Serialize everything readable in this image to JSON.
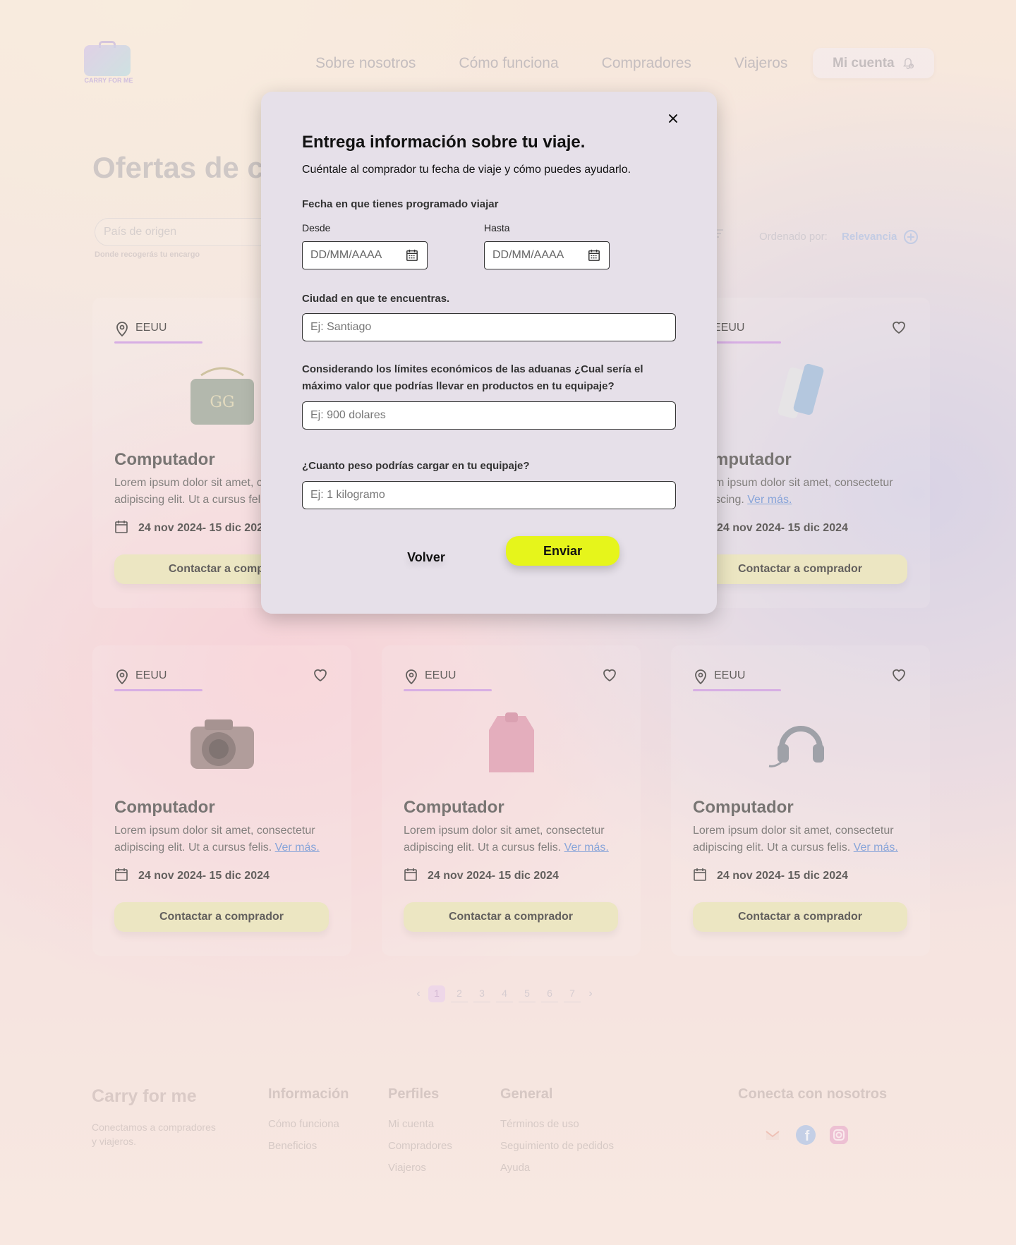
{
  "brand": {
    "logo_text": "CARRY FOR ME"
  },
  "nav": {
    "items": [
      "Sobre nosotros",
      "Cómo funciona",
      "Compradores",
      "Viajeros"
    ],
    "account_label": "Mi cuenta"
  },
  "page": {
    "title": "Ofertas de co",
    "origin_placeholder": "País de origen",
    "origin_hint": "Donde recogerás tu encargo",
    "sort_label": "Ordenado por:",
    "sort_value": "Relevancia"
  },
  "cards": [
    {
      "location": "EEUU",
      "title": "Computador",
      "desc": "Lorem ipsum dolor sit amet, c",
      "desc2": "adipiscing elit. Ut a cursus fel",
      "more": "",
      "dates": "24 nov 2024- 15 dic 2024",
      "button": "Contactar a compra",
      "image": "handbag"
    },
    {
      "location": "EEUU",
      "title": "mputador",
      "desc": "m ipsum dolor sit amet, consectetur",
      "desc2": "scing.",
      "more": "Ver más.",
      "dates": "24 nov 2024- 15 dic 2024",
      "button": "Contactar a comprador",
      "image": "phone"
    },
    {
      "location": "EEUU",
      "title": "Computador",
      "desc": "Lorem ipsum dolor sit amet, consectetur",
      "desc2": "adipiscing elit. Ut a cursus felis.",
      "more": "Ver más.",
      "dates": "24 nov 2024- 15 dic 2024",
      "button": "Contactar a comprador",
      "image": "camera"
    },
    {
      "location": "EEUU",
      "title": "Computador",
      "desc": "Lorem ipsum dolor sit amet, consectetur",
      "desc2": "adipiscing elit. Ut a cursus felis.",
      "more": "Ver más.",
      "dates": "24 nov 2024- 15 dic 2024",
      "button": "Contactar a comprador",
      "image": "jacket"
    },
    {
      "location": "EEUU",
      "title": "Computador",
      "desc": "Lorem ipsum dolor sit amet, consectetur",
      "desc2": "adipiscing elit. Ut a cursus felis.",
      "more": "Ver más.",
      "dates": "24 nov 2024- 15 dic 2024",
      "button": "Contactar a comprador",
      "image": "headset"
    }
  ],
  "pagination": {
    "pages": [
      "1",
      "2",
      "3",
      "4",
      "5",
      "6",
      "7"
    ],
    "current": "1"
  },
  "footer": {
    "brand": "Carry for me",
    "tagline": "Conectamos a compradores y viajeros.",
    "info_title": "Información",
    "info_links": [
      "Cómo funciona",
      "Beneficios"
    ],
    "profiles_title": "Perfiles",
    "profiles_links": [
      "Mi cuenta",
      "Compradores",
      "Viajeros"
    ],
    "general_title": "General",
    "general_links": [
      "Términos de uso",
      "Seguimiento de pedidos",
      "Ayuda"
    ],
    "connect_title": "Conecta con nosotros",
    "social": [
      "gmail-icon",
      "facebook-icon",
      "instagram-icon"
    ]
  },
  "modal": {
    "title": "Entrega información sobre tu viaje.",
    "subtitle": "Cuéntale al comprador tu fecha de viaje y cómo puedes ayudarlo.",
    "date_section_label": "Fecha en que tienes programado viajar",
    "from_label": "Desde",
    "to_label": "Hasta",
    "date_placeholder": "DD/MM/AAAA",
    "city_label": "Ciudad en que te encuentras.",
    "city_placeholder": "Ej: Santiago",
    "value_label": "Considerando los límites económicos de las aduanas ¿Cual sería el máximo valor que podrías llevar en productos en tu equipaje?",
    "value_placeholder": "Ej: 900 dolares",
    "weight_label": "¿Cuanto peso podrías cargar en tu equipaje?",
    "weight_placeholder": "Ej: 1 kilogramo",
    "back_label": "Volver",
    "send_label": "Enviar"
  },
  "colors": {
    "accent": "#e6f51b",
    "modal_bg": "#e6e0e9",
    "link": "#4a7bd0",
    "location_bar": "#c58ae0"
  }
}
